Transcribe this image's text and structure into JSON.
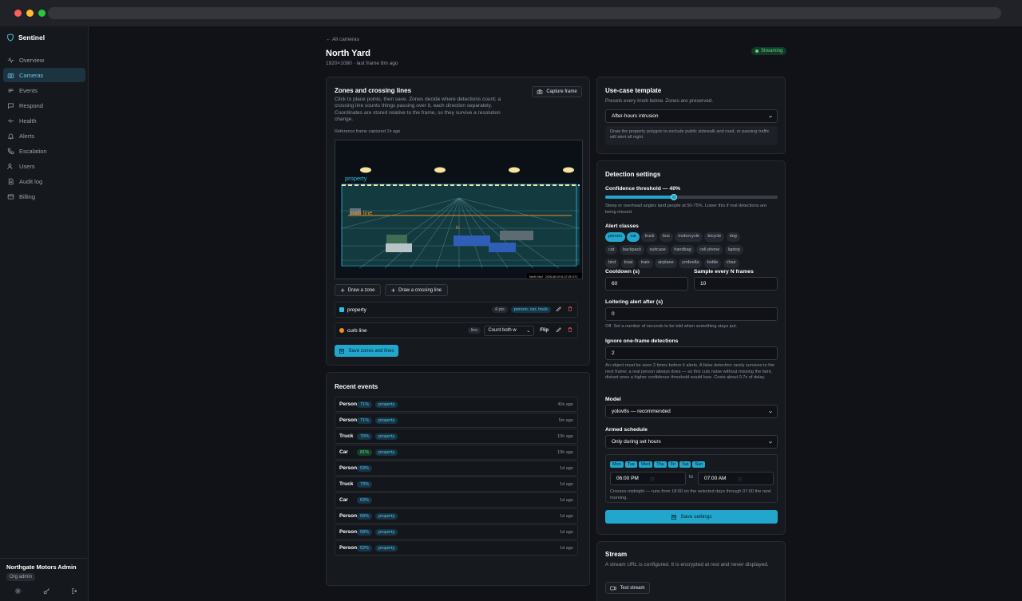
{
  "app": {
    "name": "Sentinel"
  },
  "colors": {
    "accent": "#22a6cc",
    "zone_property": "#22c3e6",
    "zone_curb": "#f28c28",
    "status_green": "#4ade80"
  },
  "nav": [
    {
      "label": "Overview",
      "icon": "activity-icon"
    },
    {
      "label": "Cameras",
      "icon": "camera-icon",
      "active": true
    },
    {
      "label": "Events",
      "icon": "events-icon"
    },
    {
      "label": "Respond",
      "icon": "respond-icon"
    },
    {
      "label": "Health",
      "icon": "health-icon"
    },
    {
      "label": "Alerts",
      "icon": "alert-icon"
    },
    {
      "label": "Escalation",
      "icon": "phone-icon"
    },
    {
      "label": "Users",
      "icon": "users-icon"
    },
    {
      "label": "Audit log",
      "icon": "log-icon"
    },
    {
      "label": "Billing",
      "icon": "billing-icon"
    }
  ],
  "footer": {
    "org": "Northgate Motors Admin",
    "role": "Org admin"
  },
  "header": {
    "back": "← All cameras",
    "title": "North Yard",
    "subtitle": "1920×1080 · last frame 8m ago",
    "status": "Streaming"
  },
  "zones_card": {
    "title": "Zones and crossing lines",
    "desc": "Click to place points, then save. Zones decide where detections count; a crossing line counts things passing over it, each direction separately. Coordinates are stored relative to the frame, so they survive a resolution change.",
    "ref": "Reference frame captured 1h ago",
    "capture": "Capture frame",
    "frame_zone_label": "property",
    "frame_line_label": "curb line",
    "frame_in": "in",
    "frame_caption": "North Yard",
    "frame_timestamp": "2026-08-19 01:27:25 UTC",
    "draw_zone": "Draw a zone",
    "draw_line": "Draw a crossing line",
    "zones": [
      {
        "name": "property",
        "points": "4 pts",
        "classes": "person, car, truck"
      },
      {
        "name": "curb line",
        "type": "line",
        "direction": "Count both w",
        "flip": "Flip"
      }
    ],
    "save": "Save zones and lines"
  },
  "events_card": {
    "title": "Recent events",
    "events": [
      {
        "label": "Person",
        "pct": "71%",
        "zone": "property",
        "time": "40s ago"
      },
      {
        "label": "Person",
        "pct": "71%",
        "zone": "property",
        "time": "5m ago"
      },
      {
        "label": "Truck",
        "pct": "70%",
        "zone": "property",
        "time": "10h ago"
      },
      {
        "label": "Car",
        "pct": "81%",
        "zone": "property",
        "time": "19h ago",
        "green": true
      },
      {
        "label": "Person",
        "pct": "53%",
        "zone": "",
        "time": "1d ago"
      },
      {
        "label": "Truck",
        "pct": "73%",
        "zone": "",
        "time": "1d ago"
      },
      {
        "label": "Car",
        "pct": "63%",
        "zone": "",
        "time": "1d ago"
      },
      {
        "label": "Person",
        "pct": "69%",
        "zone": "property",
        "time": "1d ago"
      },
      {
        "label": "Person",
        "pct": "58%",
        "zone": "property",
        "time": "1d ago"
      },
      {
        "label": "Person",
        "pct": "52%",
        "zone": "property",
        "time": "1d ago"
      }
    ]
  },
  "template_card": {
    "title": "Use-case template",
    "desc": "Presets every knob below. Zones are preserved.",
    "selected": "After-hours intrusion",
    "hint": "Draw the property polygon to exclude public sidewalk and road, or passing traffic will alert all night."
  },
  "detection": {
    "title": "Detection settings",
    "confidence_label": "Confidence threshold — 40%",
    "confidence": 0.4,
    "confidence_help": "Steep or overhead angles land people at 50-75%. Lower this if real detections are being missed.",
    "classes_label": "Alert classes",
    "classes": [
      {
        "n": "person",
        "s": true
      },
      {
        "n": "car",
        "s": true
      },
      {
        "n": "truck"
      },
      {
        "n": "bus"
      },
      {
        "n": "motorcycle"
      },
      {
        "n": "bicycle"
      },
      {
        "n": "dog"
      },
      {
        "n": "cat"
      },
      {
        "n": "backpack"
      },
      {
        "n": "suitcase"
      },
      {
        "n": "handbag"
      },
      {
        "n": "cell phone"
      },
      {
        "n": "laptop"
      },
      {
        "n": "bird"
      },
      {
        "n": "boat"
      },
      {
        "n": "train"
      },
      {
        "n": "airplane"
      },
      {
        "n": "umbrella"
      },
      {
        "n": "bottle"
      },
      {
        "n": "chair"
      }
    ],
    "cooldown_label": "Cooldown (s)",
    "cooldown": "60",
    "sample_label": "Sample every N frames",
    "sample": "10",
    "loiter_label": "Loitering alert after (s)",
    "loiter": "0",
    "loiter_help": "Off. Set a number of seconds to be told when something stays put.",
    "ignore_label": "Ignore one-frame detections",
    "ignore": "2",
    "ignore_help": "An object must be seen 2 times before it alerts. A false detection rarely survives to the next frame; a real person always does — so this cuts noise without missing the faint, distant ones a higher confidence threshold would lose. Costs about 0.7s of delay.",
    "model_label": "Model",
    "model": "yolov8s — recommended",
    "schedule_label": "Armed schedule",
    "schedule": "Only during set hours",
    "days": [
      "Mon",
      "Tue",
      "Wed",
      "Thu",
      "Fri",
      "Sat",
      "Sun"
    ],
    "from": "06:00 PM",
    "to_word": "to",
    "to": "07:00 AM",
    "schedule_help": "Crosses midnight — runs from 18:00 on the selected days through 07:00 the next morning.",
    "save": "Save settings"
  },
  "stream": {
    "title": "Stream",
    "desc": "A stream URL is configured. It is encrypted at rest and never displayed.",
    "test": "Test stream"
  }
}
